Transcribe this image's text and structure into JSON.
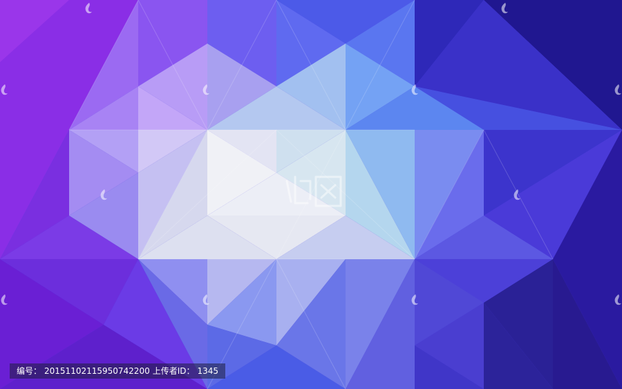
{
  "image": {
    "description_colors": {
      "primary": "#4a3fe0",
      "secondary": "#8e2fe6",
      "highlight": "#f3f4f7",
      "accent": "#8fc0f0"
    }
  },
  "info_bar": {
    "id_label": "编号：",
    "id_value": "20151102115950742200",
    "uploader_label": "上传者ID：",
    "uploader_value": "1345"
  }
}
